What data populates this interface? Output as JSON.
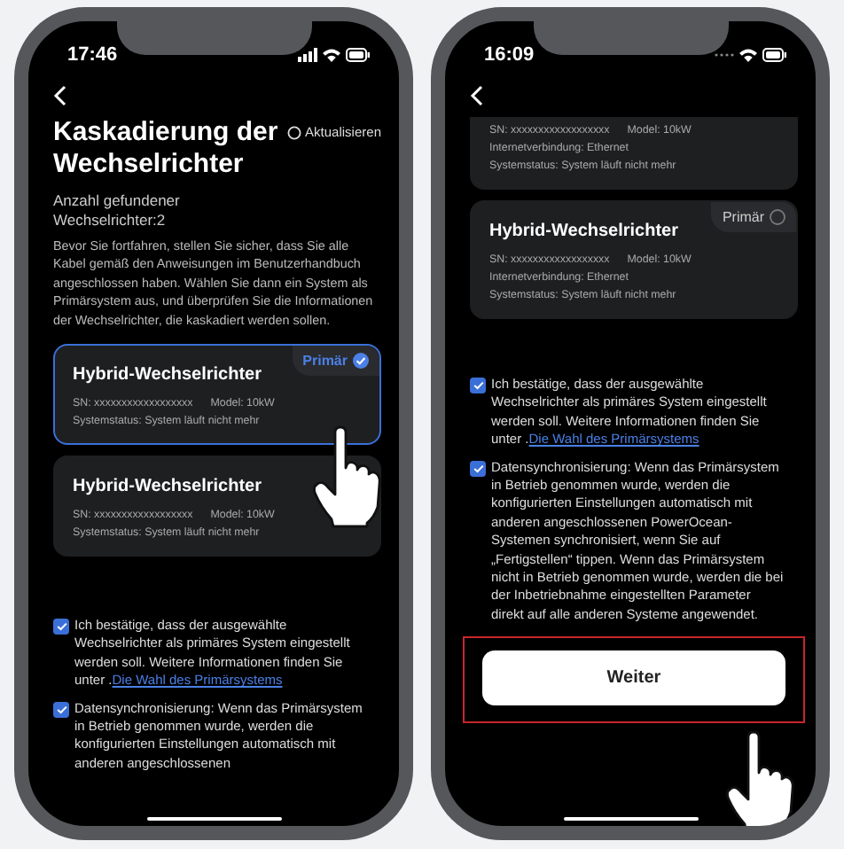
{
  "phones": [
    {
      "time": "17:46",
      "signal_bars": true,
      "title": "Kaskadierung der Wechselrichter",
      "refresh": "Aktualisieren",
      "count": "Anzahl gefundener Wechselrichter:2",
      "intro": "Bevor Sie fortfahren, stellen Sie sicher, dass Sie alle Kabel gemäß den Anweisungen im Benutzerhandbuch angeschlossen haben. Wählen Sie dann ein System als Primärsystem aus, und überprüfen Sie die Informationen der Wechselrichter, die kaskadiert werden sollen.",
      "cards": [
        {
          "name": "Hybrid-Wechselrichter",
          "tapped": true,
          "primary": {
            "label": "Primär",
            "selected": true
          },
          "sn": "SN: xxxxxxxxxxxxxxxxxx",
          "model": "Model: 10kW",
          "lines": [
            "Systemstatus: System läuft nicht mehr"
          ]
        },
        {
          "name": "Hybrid-Wechselrichter",
          "sn": "SN: xxxxxxxxxxxxxxxxxx",
          "model": "Model: 10kW",
          "lines": [
            "Systemstatus: System läuft nicht mehr"
          ]
        }
      ],
      "checks": [
        {
          "checked": true,
          "text": "Ich bestätige, dass der ausgewählte Wechselrichter als primäres System eingestellt werden soll. Weitere Informationen finden Sie unter .",
          "link": "Die Wahl des Primärsystems"
        },
        {
          "checked": true,
          "text": "Datensynchronisierung: Wenn das Primärsystem in Betrieb genommen wurde, werden die konfigurierten Einstellungen automatisch mit anderen angeschlossenen"
        }
      ]
    },
    {
      "time": "16:09",
      "signal_bars": false,
      "cards": [
        {
          "sn": "SN: xxxxxxxxxxxxxxxxxx",
          "model": "Model: 10kW",
          "lines": [
            "Internetverbindung: Ethernet",
            "Systemstatus: System läuft nicht mehr"
          ]
        },
        {
          "name": "Hybrid-Wechselrichter",
          "primary": {
            "label": "Primär",
            "selected": false
          },
          "sn": "SN: xxxxxxxxxxxxxxxxxx",
          "model": "Model: 10kW",
          "lines": [
            "Internetverbindung: Ethernet",
            "Systemstatus: System läuft nicht mehr"
          ]
        }
      ],
      "checks": [
        {
          "checked": true,
          "text": "Ich bestätige, dass der ausgewählte Wechselrichter als primäres System eingestellt werden soll. Weitere Informationen finden Sie unter .",
          "link": "Die Wahl des Primärsystems"
        },
        {
          "checked": true,
          "text": "Datensynchronisierung: Wenn das Primärsystem in Betrieb genommen wurde, werden die konfigurierten Einstellungen automatisch mit anderen angeschlossenen PowerOcean-Systemen synchronisiert, wenn Sie auf „Fertigstellen“ tippen. Wenn das Primärsystem nicht in Betrieb genommen wurde, werden die bei der Inbetriebnahme eingestellten Parameter direkt auf alle anderen Systeme angewendet."
        }
      ],
      "button": {
        "label": "Weiter",
        "tapped": true
      }
    }
  ]
}
